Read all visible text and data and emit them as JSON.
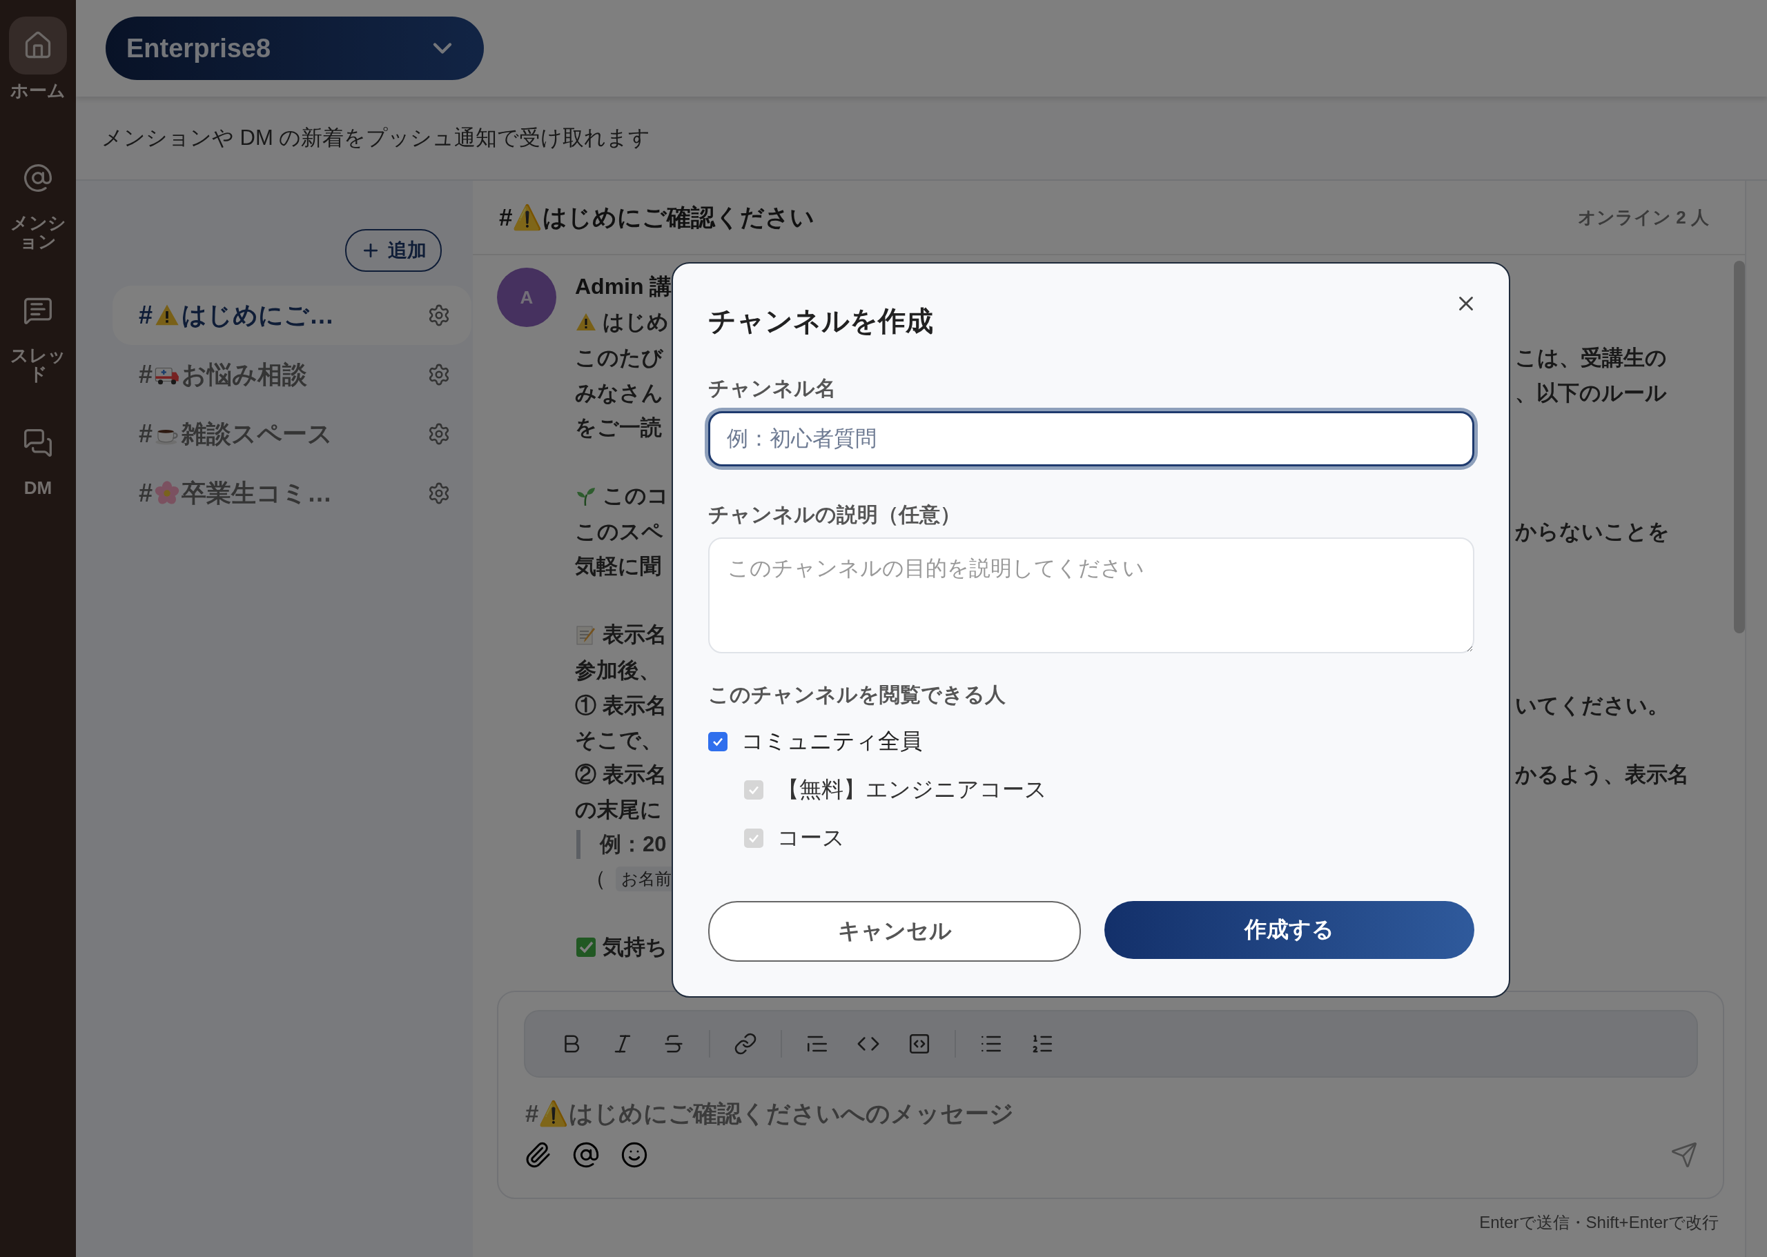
{
  "rail": [
    {
      "label": "ホーム",
      "selected": true
    },
    {
      "label": "メンション",
      "selected": false
    },
    {
      "label": "スレッド",
      "selected": false
    },
    {
      "label": "DM",
      "selected": false
    }
  ],
  "workspace": {
    "name": "Enterprise8"
  },
  "notice": "メンションや DM の新着をプッシュ通知で受け取れます",
  "sidebar": {
    "add_label": "追加",
    "channels": [
      {
        "prefix": "#",
        "name": "はじめにご…",
        "selected": true
      },
      {
        "prefix": "#",
        "name": "お悩み相談",
        "selected": false
      },
      {
        "prefix": "#",
        "name": "雑談スペース",
        "selected": false
      },
      {
        "prefix": "#",
        "name": "卒業生コミ…",
        "selected": false
      }
    ]
  },
  "chat": {
    "title": "#⚠️はじめにご確認ください",
    "online": "オンライン 2 人",
    "message": {
      "avatar": "A",
      "author": "Admin 講",
      "lines": [
        {
          "kind": "emoji",
          "text": "はじめ"
        },
        {
          "kind": "text",
          "text": "このたび",
          "right": "こは、受講生の"
        },
        {
          "kind": "text",
          "text": "みなさん",
          "right": "、以下のルール"
        },
        {
          "kind": "text",
          "text": "をご一読"
        },
        {
          "kind": "blank"
        },
        {
          "kind": "emoji",
          "text": "このコ"
        },
        {
          "kind": "text",
          "text": "このスペ",
          "right": "からないことを"
        },
        {
          "kind": "text",
          "text": "気軽に聞"
        },
        {
          "kind": "blank"
        },
        {
          "kind": "emoji",
          "text": "表示名"
        },
        {
          "kind": "text",
          "text": "参加後、"
        },
        {
          "kind": "text",
          "text": "① 表示名",
          "right": "いてください。"
        },
        {
          "kind": "text",
          "text": "そこで、"
        },
        {
          "kind": "text",
          "text": "② 表示名",
          "right": "かるよう、表示名"
        },
        {
          "kind": "text",
          "text": "の末尾に"
        },
        {
          "kind": "quote",
          "text": "例：20"
        },
        {
          "kind": "code",
          "text": "（",
          "code": "お名前"
        },
        {
          "kind": "blank"
        },
        {
          "kind": "emoji",
          "text": "気持ち"
        }
      ]
    }
  },
  "composer": {
    "placeholder": "#⚠️はじめにご確認くださいへのメッセージ",
    "hint": "Enterで送信・Shift+Enterで改行"
  },
  "modal": {
    "title": "チャンネルを作成",
    "name_label": "チャンネル名",
    "name_placeholder": "例：初心者質問",
    "name_focused": true,
    "desc_label": "チャンネルの説明（任意）",
    "desc_placeholder": "このチャンネルの目的を説明してください",
    "visibility_label": "このチャンネルを閲覧できる人",
    "visibility": [
      {
        "label": "コミュニティ全員",
        "checked": true,
        "disabled": false,
        "children": [
          {
            "label": "【無料】エンジニアコース",
            "checked": true,
            "disabled": true
          },
          {
            "label": "コース",
            "checked": true,
            "disabled": true
          }
        ]
      }
    ],
    "cancel": "キャンセル",
    "submit": "作成する"
  }
}
